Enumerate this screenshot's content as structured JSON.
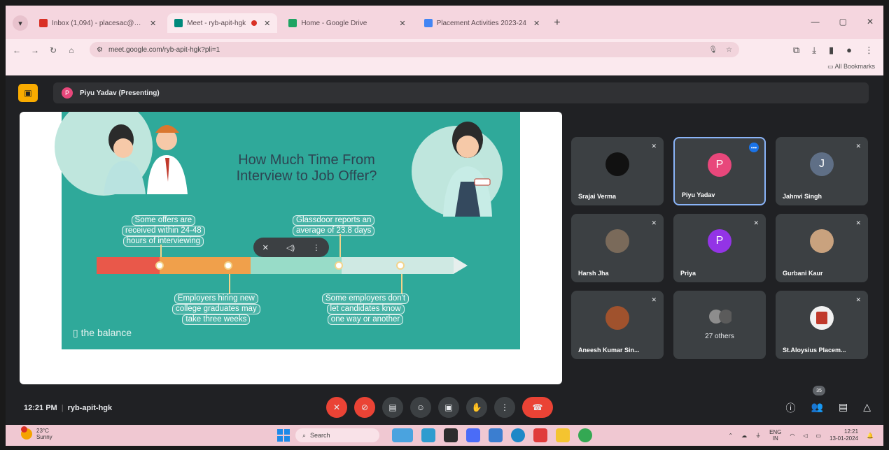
{
  "browser": {
    "tabs": [
      {
        "label": "Inbox (1,094) - placesac@gma",
        "favicon_color": "#d93025",
        "active": false
      },
      {
        "label": "Meet - ryb-apit-hgk",
        "favicon_color": "#00897b",
        "active": true
      },
      {
        "label": "Home - Google Drive",
        "favicon_color": "#1fa463",
        "active": false
      },
      {
        "label": "Placement Activities 2023-24",
        "favicon_color": "#4285f4",
        "active": false
      }
    ],
    "url": "meet.google.com/ryb-apit-hgk?pli=1",
    "bookmarks_label": "All Bookmarks"
  },
  "meet": {
    "presenter_initial": "P",
    "presenter_label": "Piyu Yadav (Presenting)",
    "slide": {
      "title_line1": "How Much Time From",
      "title_line2": "Interview to Job Offer?",
      "callouts": [
        [
          "Some offers are",
          "received within 24-48",
          "hours of interviewing"
        ],
        [
          "Glassdoor reports an",
          "average of 23.8 days"
        ],
        [
          "Employers hiring new",
          "college graduates may",
          "take three weeks"
        ],
        [
          "Some employers don't",
          "let candidates know",
          "one way or another"
        ]
      ],
      "brand": "the balance"
    },
    "participants": [
      {
        "name": "Srajai Verma",
        "initial": "",
        "avatar_color": "#111111"
      },
      {
        "name": "Piyu Yadav",
        "initial": "P",
        "avatar_color": "#e8477b"
      },
      {
        "name": "Jahnvi Singh",
        "initial": "J",
        "avatar_color": "#5f6f86"
      },
      {
        "name": "Harsh Jha",
        "initial": "",
        "avatar_color": "#7a6a5a"
      },
      {
        "name": "Priya",
        "initial": "P",
        "avatar_color": "#9334e6"
      },
      {
        "name": "Gurbani Kaur",
        "initial": "",
        "avatar_color": "#c9a27e"
      },
      {
        "name": "Aneesh Kumar Sin...",
        "initial": "",
        "avatar_color": "#a0522d"
      },
      {
        "name": "27 others",
        "initial": "",
        "avatar_color": "#6b6b6b"
      },
      {
        "name": "St.Aloysius Placem...",
        "initial": "",
        "avatar_color": "#c0392b"
      }
    ],
    "time": "12:21 PM",
    "meeting_code": "ryb-apit-hgk",
    "participant_count": "35"
  },
  "taskbar": {
    "temperature": "23°C",
    "weather": "Sunny",
    "search_placeholder": "Search",
    "lang_line1": "ENG",
    "lang_line2": "IN",
    "clock_time": "12:21",
    "clock_date": "13-01-2024"
  }
}
